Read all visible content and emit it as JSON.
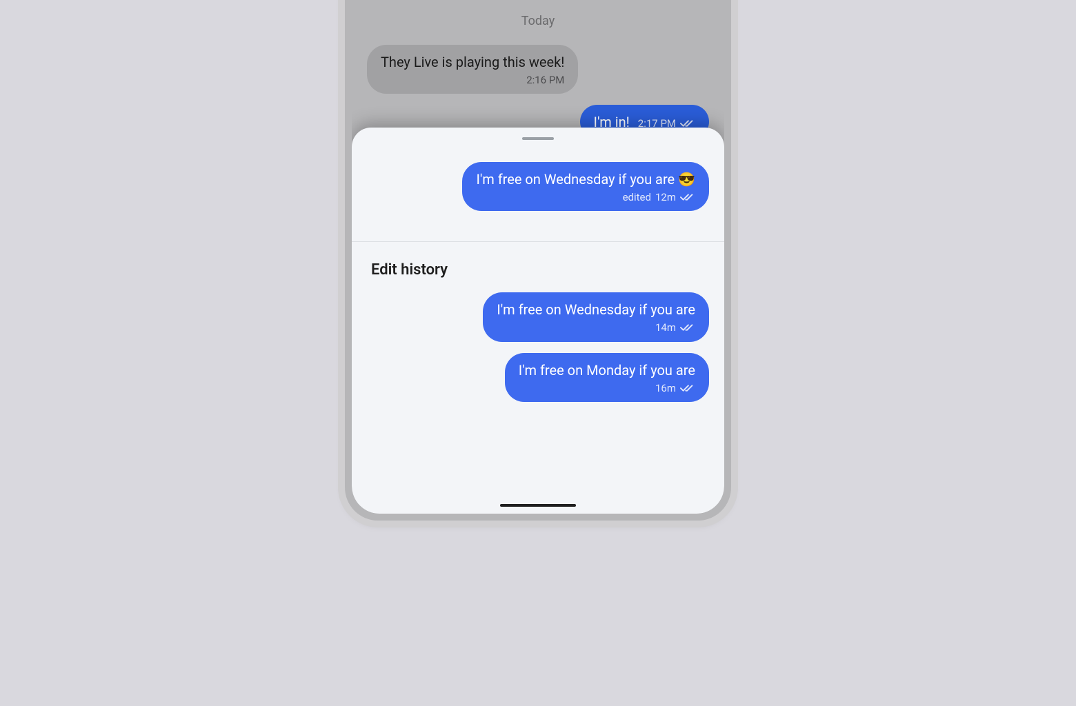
{
  "chat": {
    "date_separator": "Today",
    "messages": [
      {
        "side": "received",
        "text": "They Live is playing this week!",
        "time": "2:16 PM"
      },
      {
        "side": "sent",
        "text": "I'm in!",
        "time": "2:17 PM"
      }
    ]
  },
  "sheet": {
    "current_message": {
      "text": "I'm free on Wednesday if you are 😎",
      "edited_label": "edited",
      "age": "12m"
    },
    "history_title": "Edit history",
    "history": [
      {
        "text": "I'm free on Wednesday if you are",
        "age": "14m"
      },
      {
        "text": "I'm free on Monday if you are",
        "age": "16m"
      }
    ]
  }
}
